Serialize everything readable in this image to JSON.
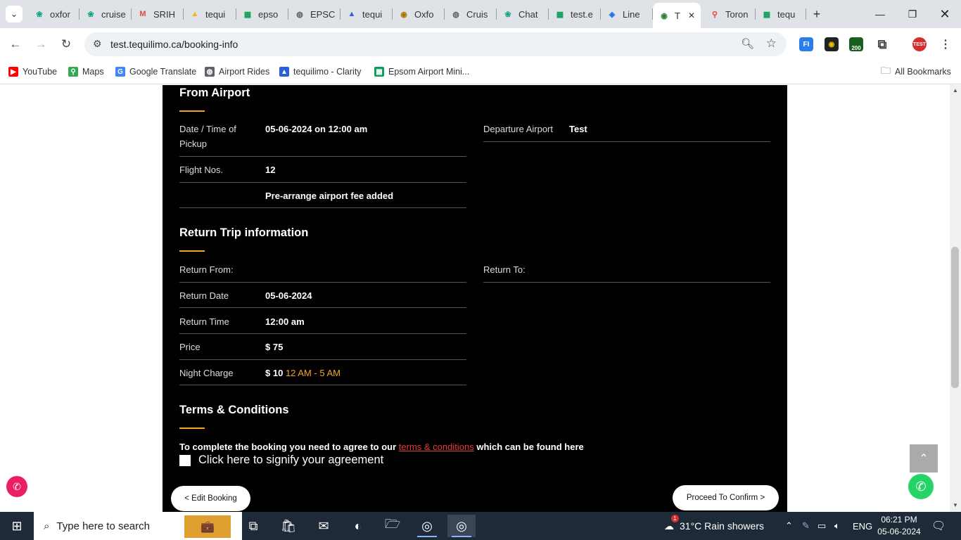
{
  "browser": {
    "tabs": [
      {
        "label": "oxfor",
        "icon": "chatgpt-icon"
      },
      {
        "label": "cruise",
        "icon": "chatgpt-icon"
      },
      {
        "label": "SRIH",
        "icon": "gmail-icon"
      },
      {
        "label": "tequi",
        "icon": "drive-icon"
      },
      {
        "label": "epso",
        "icon": "sheets-icon"
      },
      {
        "label": "EPSC",
        "icon": "globe-icon"
      },
      {
        "label": "tequi",
        "icon": "clarity-icon"
      },
      {
        "label": "Oxfo",
        "icon": "badge-icon"
      },
      {
        "label": "Cruis",
        "icon": "globe-icon"
      },
      {
        "label": "Chat",
        "icon": "chatgpt-icon"
      },
      {
        "label": "test.e",
        "icon": "sheets-icon"
      },
      {
        "label": "Line",
        "icon": "shield-icon"
      },
      {
        "label": "T",
        "icon": "site-icon",
        "active": true
      },
      {
        "label": "Toron",
        "icon": "maps-icon"
      },
      {
        "label": "tequ",
        "icon": "sheets-icon"
      }
    ],
    "url": "test.tequilimo.ca/booking-info",
    "bookmarks": [
      {
        "label": "YouTube",
        "icon": "youtube-icon"
      },
      {
        "label": "Maps",
        "icon": "maps-icon"
      },
      {
        "label": "Google Translate",
        "icon": "translate-icon"
      },
      {
        "label": "Airport Rides",
        "icon": "globe-icon"
      },
      {
        "label": "tequilimo - Clarity",
        "icon": "clarity-icon"
      },
      {
        "label": "Epsom Airport Mini...",
        "icon": "sheets-icon"
      }
    ],
    "all_bookmarks": "All Bookmarks",
    "ext_badge": "200"
  },
  "from_airport": {
    "heading": "From Airport",
    "date_label": "Date / Time of Pickup",
    "date_value": "05-06-2024  on  12:00 am",
    "departure_label": "Departure Airport",
    "departure_value": "Test",
    "flight_label": "Flight Nos.",
    "flight_value": "12",
    "fee_note": "Pre-arrange airport fee added"
  },
  "return_trip": {
    "heading": "Return Trip information",
    "from_label": "Return From:",
    "to_label": "Return To:",
    "date_label": "Return Date",
    "date_value": "05-06-2024",
    "time_label": "Return Time",
    "time_value": "12:00 am",
    "price_label": "Price",
    "price_value": "$ 75",
    "night_label": "Night Charge",
    "night_value": "$ 10",
    "night_hours": "12 AM - 5 AM"
  },
  "terms": {
    "heading": "Terms & Conditions",
    "text_before": "To complete the booking you need to agree to our ",
    "link": "terms & conditions",
    "text_after": " which can be found here",
    "checkbox_label": "Click here to signify your agreement"
  },
  "buttons": {
    "edit": "< Edit Booking",
    "confirm": "Proceed To Confirm  >"
  },
  "taskbar": {
    "search_placeholder": "Type here to search",
    "weather": "31°C  Rain showers",
    "weather_badge": "1",
    "lang": "ENG",
    "time": "06:21 PM",
    "date": "05-06-2024"
  },
  "colors": {
    "accent": "#f5a623",
    "link": "#e53935",
    "panel": "#000000"
  }
}
